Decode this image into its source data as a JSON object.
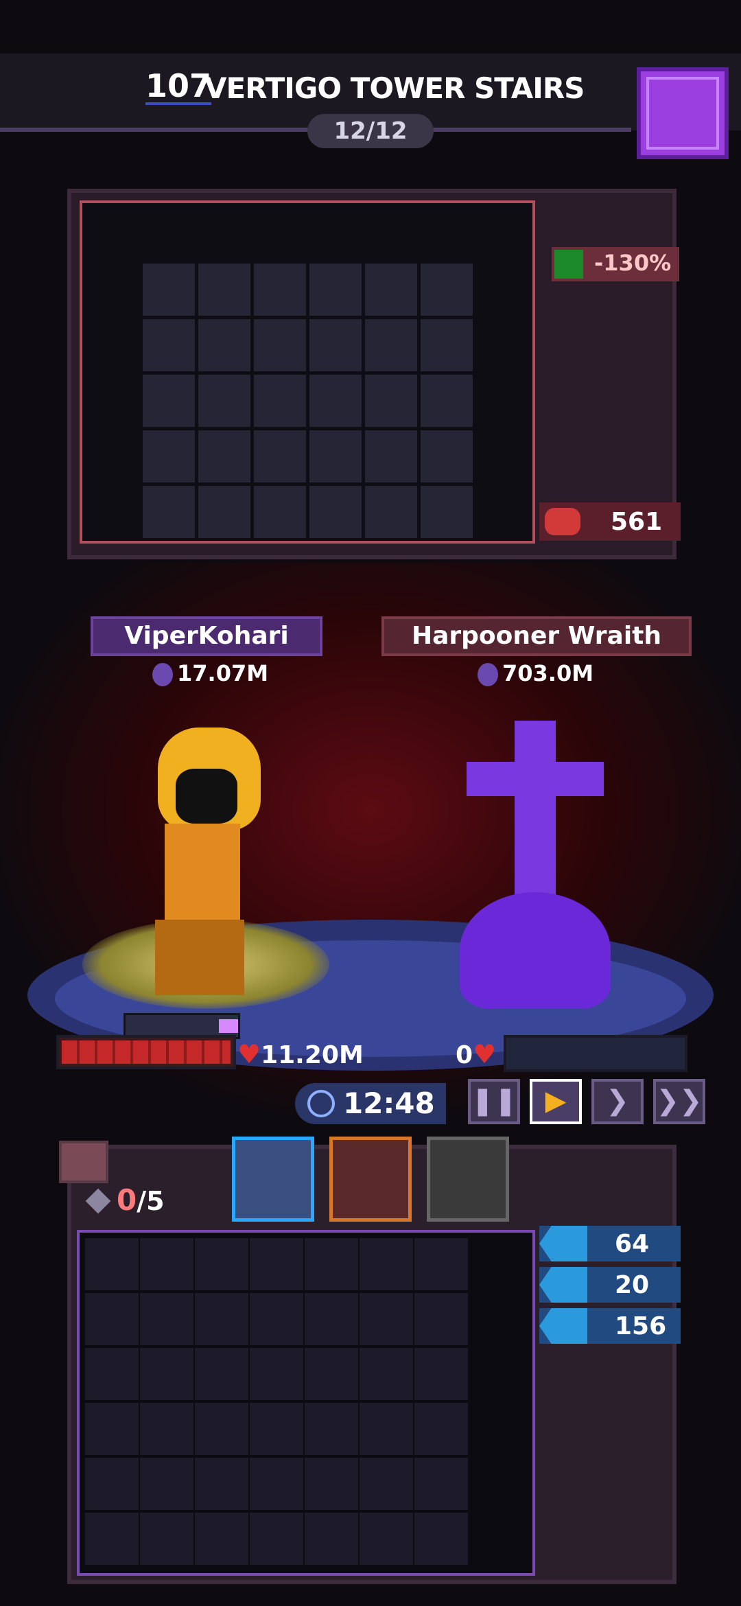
{
  "header": {
    "floor_number": "107",
    "stage_name": "VERTIGO TOWER STAIRS",
    "wave_progress": "12/12",
    "backpack_icon": "backpack-icon"
  },
  "enemy_panel": {
    "modifier_value": "-130%",
    "modifier_icon": "crossed-sword-icon",
    "hp_value": "561",
    "hp_icon": "heart-outline-icon"
  },
  "battle": {
    "player": {
      "name": "ViperKohari",
      "power": "17.07M",
      "hp": "11.20M",
      "hp_fill": 1.0
    },
    "enemy": {
      "name": "Harpooner Wraith",
      "power": "703.0M",
      "hp": "0",
      "hp_fill": 0.0
    },
    "timer": "12:48",
    "speed_controls": [
      {
        "id": "pause",
        "glyph": "❚❚",
        "active": false
      },
      {
        "id": "play",
        "glyph": "▶",
        "active": true
      },
      {
        "id": "fast",
        "glyph": "❯",
        "active": false
      },
      {
        "id": "faster",
        "glyph": "❯❯",
        "active": false
      }
    ]
  },
  "inventory": {
    "slot_used": "0",
    "slot_total": "/5",
    "tabs": [
      {
        "name": "blue-wolf-companion",
        "selected": true
      },
      {
        "name": "red-boar-companion",
        "selected": false
      },
      {
        "name": "locked-companion",
        "selected": false
      }
    ],
    "stats": [
      {
        "icon": "speed-icon",
        "value": "64"
      },
      {
        "icon": "target-icon",
        "value": "20"
      },
      {
        "icon": "boot-icon",
        "value": "156"
      }
    ]
  },
  "colors": {
    "accent_purple": "#7b4ab2",
    "hp_red": "#c42828",
    "stat_blue": "#214a80"
  }
}
